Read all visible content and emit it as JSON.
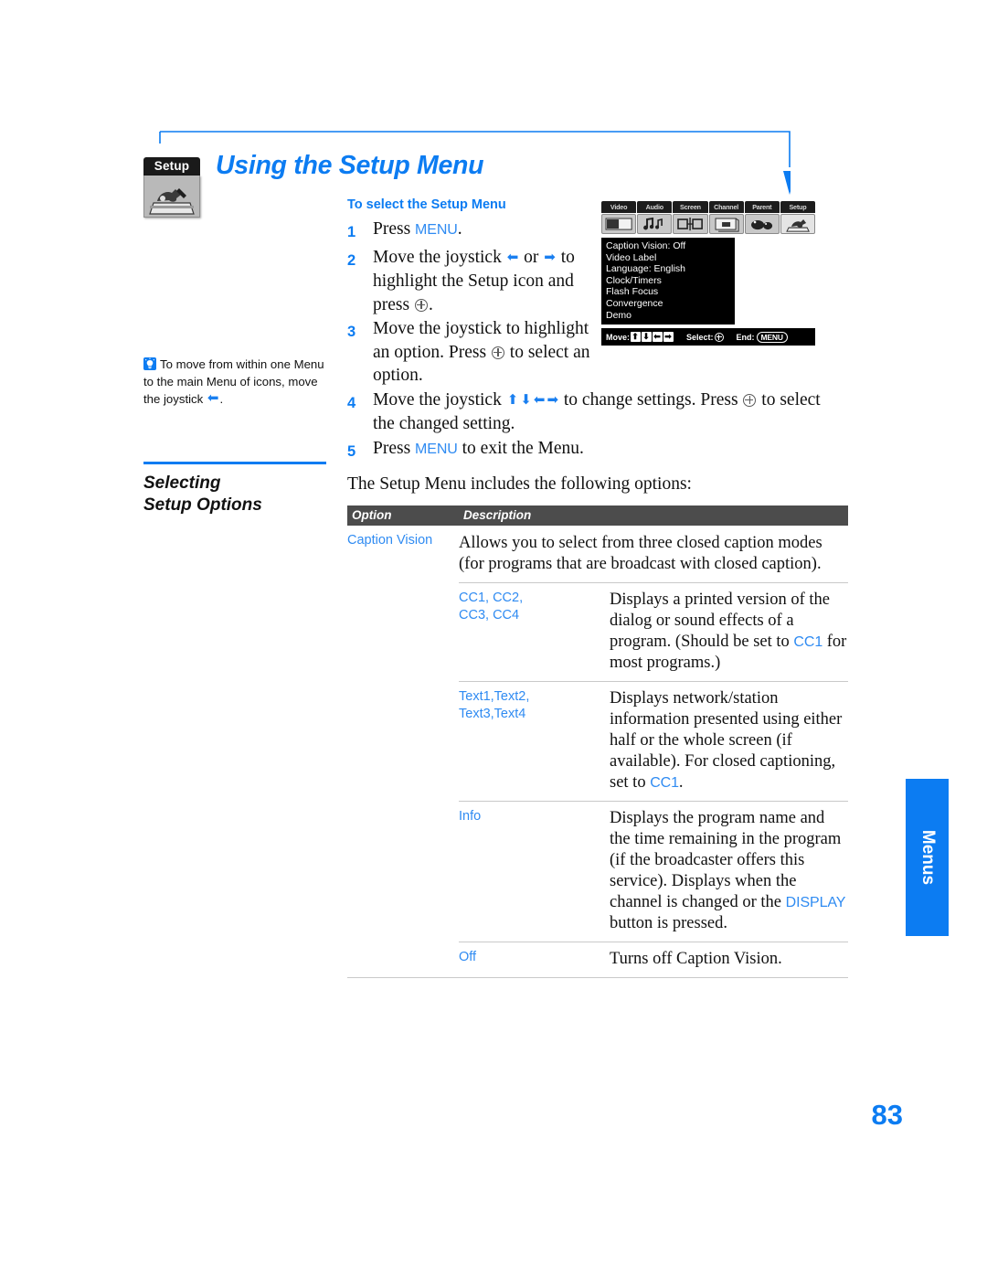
{
  "page": {
    "title": "Using the Setup Menu",
    "number": "83",
    "side_tab": "Menus",
    "badge_label": "Setup",
    "badge_icon": "toolbox-icon"
  },
  "procedure": {
    "heading": "To select the Setup Menu",
    "steps": [
      {
        "num": "1",
        "parts": [
          {
            "t": "text",
            "v": "Press "
          },
          {
            "t": "kw",
            "v": "MENU"
          },
          {
            "t": "text",
            "v": "."
          }
        ]
      },
      {
        "num": "2",
        "narrow": true,
        "parts": [
          {
            "t": "text",
            "v": "Move the joystick "
          },
          {
            "t": "arrow",
            "v": "left"
          },
          {
            "t": "text",
            "v": " or "
          },
          {
            "t": "arrow",
            "v": "right"
          },
          {
            "t": "text",
            "v": " to highlight the Setup icon and press "
          },
          {
            "t": "plus",
            "v": "circle-plus"
          },
          {
            "t": "text",
            "v": "."
          }
        ]
      },
      {
        "num": "3",
        "narrow": true,
        "parts": [
          {
            "t": "text",
            "v": "Move the joystick to highlight an option. Press "
          },
          {
            "t": "plus",
            "v": "circle-plus"
          },
          {
            "t": "text",
            "v": " to select an option."
          }
        ]
      },
      {
        "num": "4",
        "parts": [
          {
            "t": "text",
            "v": "Move the joystick "
          },
          {
            "t": "arrow",
            "v": "up"
          },
          {
            "t": "arrow",
            "v": "down"
          },
          {
            "t": "arrow",
            "v": "left"
          },
          {
            "t": "arrow",
            "v": "right"
          },
          {
            "t": "text",
            "v": " to change settings. Press "
          },
          {
            "t": "plus",
            "v": "circle-plus"
          },
          {
            "t": "text",
            "v": " to select the changed setting."
          }
        ]
      },
      {
        "num": "5",
        "parts": [
          {
            "t": "text",
            "v": "Press "
          },
          {
            "t": "kw",
            "v": "MENU"
          },
          {
            "t": "text",
            "v": " to exit the Menu."
          }
        ]
      }
    ]
  },
  "tv_screen": {
    "tabs": [
      {
        "label": "Video",
        "icon": "video-icon",
        "selected": false
      },
      {
        "label": "Audio",
        "icon": "audio-icon",
        "selected": false
      },
      {
        "label": "Screen",
        "icon": "screen-icon",
        "selected": false
      },
      {
        "label": "Channel",
        "icon": "channel-icon",
        "selected": false
      },
      {
        "label": "Parent",
        "icon": "parent-icon",
        "selected": false
      },
      {
        "label": "Setup",
        "icon": "setup-icon",
        "selected": true
      }
    ],
    "menu_items": [
      "Caption Vision: Off",
      "Video Label",
      "Language: English",
      "Clock/Timers",
      "Flash Focus",
      "Convergence",
      "Demo"
    ],
    "status_bar": {
      "move_label": "Move:",
      "keys": [
        "⬆",
        "⬇",
        "⬅",
        "➡"
      ],
      "select_label": "Select:",
      "end_label": "End:",
      "end_button": "MENU"
    }
  },
  "tip": {
    "icon": "lightbulb-icon",
    "parts": [
      {
        "t": "text",
        "v": "To move from within one Menu to the main Menu of icons, move the joystick "
      },
      {
        "t": "arrow",
        "v": "left"
      },
      {
        "t": "text",
        "v": "."
      }
    ]
  },
  "section": {
    "title_line1": "Selecting",
    "title_line2": "Setup Options",
    "intro": "The Setup Menu includes the following options:"
  },
  "table": {
    "headers": {
      "option": "Option",
      "description": "Description"
    },
    "main_row": {
      "option": "Caption Vision",
      "description": "Allows you to select from three closed caption modes (for programs that are broadcast with closed caption)."
    },
    "sub_rows": [
      {
        "option": "CC1, CC2,\nCC3, CC4",
        "desc_parts": [
          {
            "t": "text",
            "v": "Displays a printed version of the dialog or sound effects of a program. (Should be set to "
          },
          {
            "t": "kw",
            "v": "CC1"
          },
          {
            "t": "text",
            "v": " for most programs.)"
          }
        ]
      },
      {
        "option": "Text1,Text2,\nText3,Text4",
        "desc_parts": [
          {
            "t": "text",
            "v": "Displays network/station information presented using either half or the whole screen (if available). For closed captioning, set to "
          },
          {
            "t": "kw",
            "v": "CC1"
          },
          {
            "t": "text",
            "v": "."
          }
        ]
      },
      {
        "option": "Info",
        "desc_parts": [
          {
            "t": "text",
            "v": "Displays the program name and the time remaining in the program (if the broadcaster offers this service). Displays when the channel is changed or the "
          },
          {
            "t": "kw",
            "v": "DISPLAY"
          },
          {
            "t": "text",
            "v": " button is pressed."
          }
        ]
      },
      {
        "option": "Off",
        "desc_parts": [
          {
            "t": "text",
            "v": "Turns off Caption Vision."
          }
        ]
      }
    ]
  },
  "colors": {
    "accent_blue": "#0c7cf2",
    "link_blue": "#2f8bf2",
    "table_header_bg": "#4c4c4c",
    "rule_gray": "#c9c9c9"
  }
}
